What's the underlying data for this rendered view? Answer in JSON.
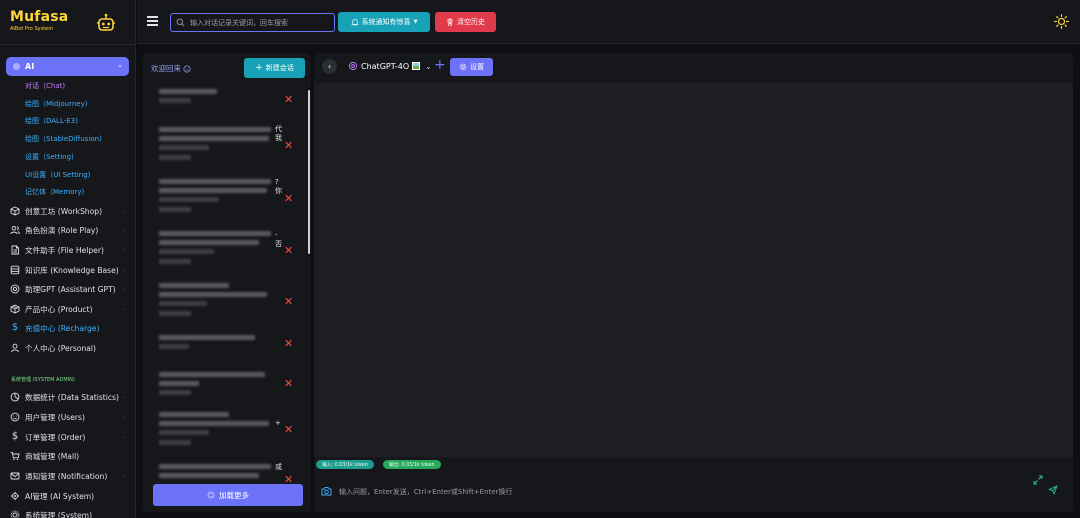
{
  "brand": {
    "name": "Mufasa",
    "subtitle": "AIBot Pro System"
  },
  "sidebar": {
    "ai_group": {
      "label": "AI",
      "expanded": true
    },
    "ai_sub_items": [
      {
        "label": "对话（Chat)",
        "active": true
      },
      {
        "label": "绘图（Midjourney)"
      },
      {
        "label": "绘图（DALL-E3)"
      },
      {
        "label": "绘图（StableDiffusion)"
      },
      {
        "label": "设置（Setting)"
      },
      {
        "label": "UI设置（UI Setting)"
      },
      {
        "label": "记忆体（Memory)"
      }
    ],
    "menu_items": [
      {
        "label": "创意工坊 (WorkShop)",
        "icon": "cube-icon"
      },
      {
        "label": "角色扮演 (Role Play)",
        "icon": "users-icon"
      },
      {
        "label": "文件助手 (File Helper)",
        "icon": "file-icon"
      },
      {
        "label": "知识库 (Knowledge Base)",
        "icon": "database-icon"
      },
      {
        "label": "助理GPT (Assistant GPT)",
        "icon": "assistant-icon"
      },
      {
        "label": "产品中心 (Product)",
        "icon": "box-icon"
      },
      {
        "label": "充值中心 (Recharge)",
        "icon": "dollar-icon",
        "highlight": true
      },
      {
        "label": "个人中心 (Personal)",
        "icon": "user-icon"
      }
    ],
    "admin_section_label": "系统管理 (SYSTEM ADMIN)",
    "admin_items": [
      {
        "label": "数据统计 (Data Statistics)",
        "icon": "chart-icon"
      },
      {
        "label": "用户管理 (Users)",
        "icon": "smile-icon"
      },
      {
        "label": "订单管理 (Order)",
        "icon": "dollar-icon"
      },
      {
        "label": "商城管理 (Mall)",
        "icon": "cart-icon"
      },
      {
        "label": "通知管理 (Notification)",
        "icon": "mail-icon"
      },
      {
        "label": "AI管理 (AI System)",
        "icon": "cpu-icon"
      },
      {
        "label": "系统管理 (System)",
        "icon": "gear-icon"
      }
    ]
  },
  "topbar": {
    "search_placeholder": "输入对话记录关键词，回车搜索",
    "notify_label": "系统通知有惊喜",
    "clear_label": "清空历史"
  },
  "chat_list": {
    "welcome": "欢迎回来",
    "new_chat_label": "新建会话",
    "load_more_label": "加载更多",
    "rows": [
      {
        "frag": ""
      },
      {
        "frag": "代\n我"
      },
      {
        "frag": "?\n你"
      },
      {
        "frag": "-\n否"
      },
      {
        "frag": ""
      },
      {
        "frag": ""
      },
      {
        "frag": ""
      },
      {
        "frag": "+"
      },
      {
        "frag": "或"
      }
    ]
  },
  "chat": {
    "model_name": "ChatGPT-4O",
    "settings_label": "设置",
    "token_input": "输入: 0.03/1k token",
    "token_output": "输出: 0.03/1k token",
    "input_placeholder": "输入问题，Enter发送，Ctrl+Enter或Shift+Enter换行"
  },
  "colors": {
    "accent": "#6c73f8",
    "teal": "#17a2b8",
    "danger": "#e03b4b",
    "brand_yellow": "#ffd43b",
    "link_blue": "#3db1ff",
    "active_purple": "#c07bff"
  }
}
